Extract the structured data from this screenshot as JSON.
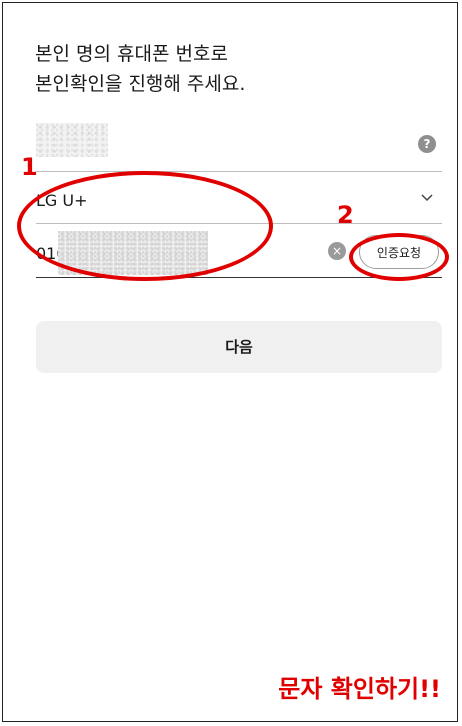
{
  "headline": {
    "line1": "본인 명의 휴대폰 번호로",
    "line2": "본인확인을 진행해 주세요."
  },
  "name_field": {
    "help_icon": "?"
  },
  "carrier_field": {
    "value": "LG U+",
    "icon": "chevron-down-icon"
  },
  "phone_field": {
    "prefix": "010",
    "clear_icon": "×",
    "verify_label": "인증요청"
  },
  "next_button": {
    "label": "다음"
  },
  "annotations": {
    "step1": "1",
    "step2": "2",
    "note": "문자 확인하기!!",
    "color": "#e10000"
  }
}
